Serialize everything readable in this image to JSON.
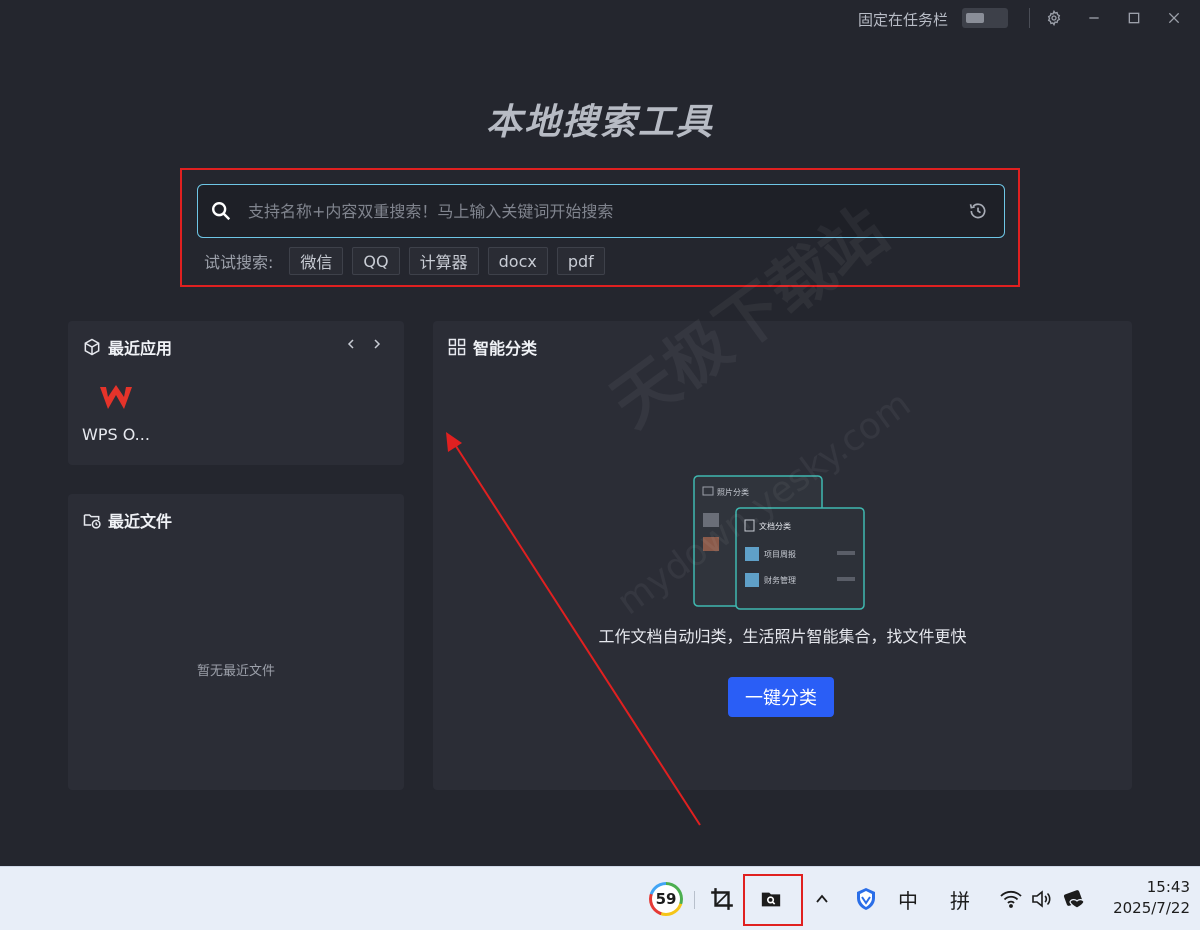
{
  "titlebar": {
    "pin_label": "固定在任务栏"
  },
  "app_title": "本地搜索工具",
  "search": {
    "placeholder": "支持名称+内容双重搜索！马上输入关键词开始搜索",
    "value": "",
    "suggest_label": "试试搜索:",
    "suggestions": [
      "微信",
      "QQ",
      "计算器",
      "docx",
      "pdf"
    ]
  },
  "recent_apps": {
    "title": "最近应用",
    "items": [
      {
        "name": "WPS O...",
        "icon": "wps-logo-icon"
      }
    ]
  },
  "recent_files": {
    "title": "最近文件",
    "empty_text": "暂无最近文件"
  },
  "smart_classify": {
    "title": "智能分类",
    "illustration": {
      "card_back_title": "照片分类",
      "card_front_title": "文档分类",
      "row1": "项目周报",
      "row2": "财务管理"
    },
    "description": "工作文档自动归类，生活照片智能集合，找文件更快",
    "button_label": "一键分类"
  },
  "watermark": {
    "text": "天极下载站",
    "sub": "mydown.yesky.com"
  },
  "taskbar": {
    "security_score": "59",
    "ime_lang": "中",
    "ime_mode": "拼",
    "time": "15:43",
    "date": "2025/7/22"
  },
  "colors": {
    "accent_button": "#2a5ef6",
    "search_border": "#6ec6e6",
    "annotation_red": "#e02020",
    "wps_red": "#e5332a"
  }
}
